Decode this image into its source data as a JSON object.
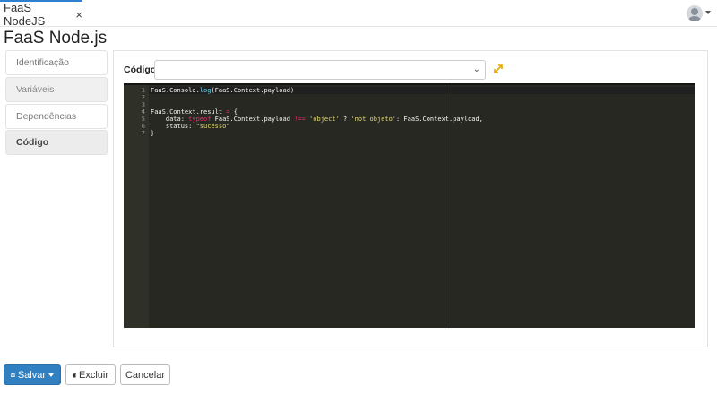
{
  "tab": {
    "title": "FaaS NodeJS",
    "close_glyph": "×"
  },
  "user": {
    "avatar_icon": "user-avatar-icon"
  },
  "page": {
    "title": "FaaS Node.js"
  },
  "sidebar": {
    "items": [
      {
        "label": "Identificação"
      },
      {
        "label": "Variáveis"
      },
      {
        "label": "Dependências"
      },
      {
        "label": "Código"
      }
    ]
  },
  "form": {
    "code_label": "Código",
    "select_value": ""
  },
  "editor": {
    "line_numbers": [
      "1",
      "2",
      "3",
      "4",
      "5",
      "6",
      "7"
    ],
    "lines": [
      [
        {
          "t": "FaaS.Console."
        },
        {
          "t": "log",
          "c": "fn"
        },
        {
          "t": "(FaaS.Context.payload)"
        }
      ],
      [],
      [],
      [
        {
          "t": "FaaS.Context.result "
        },
        {
          "t": "=",
          "c": "kw"
        },
        {
          "t": " {"
        }
      ],
      [
        {
          "t": "    data: "
        },
        {
          "t": "typeof",
          "c": "kw"
        },
        {
          "t": " FaaS.Context.payload "
        },
        {
          "t": "!==",
          "c": "kw"
        },
        {
          "t": " "
        },
        {
          "t": "'object'",
          "c": "str"
        },
        {
          "t": " ? "
        },
        {
          "t": "'not objeto'",
          "c": "str"
        },
        {
          "t": ": FaaS.Context.payload,"
        }
      ],
      [
        {
          "t": "    status: "
        },
        {
          "t": "\"sucesso\"",
          "c": "str"
        }
      ],
      [
        {
          "t": "}"
        }
      ]
    ],
    "theme": {
      "background": "#272822",
      "gutter": "#2f3129",
      "keyword": "#f92672",
      "function": "#66d9ef",
      "string": "#e6db74"
    }
  },
  "actions": {
    "save_label": "Salvar",
    "delete_label": "Excluir",
    "cancel_label": "Cancelar"
  },
  "colors": {
    "accent": "#2f7fc1",
    "tab_indicator": "#2f80d0",
    "expand_icon": "#e6a700"
  }
}
